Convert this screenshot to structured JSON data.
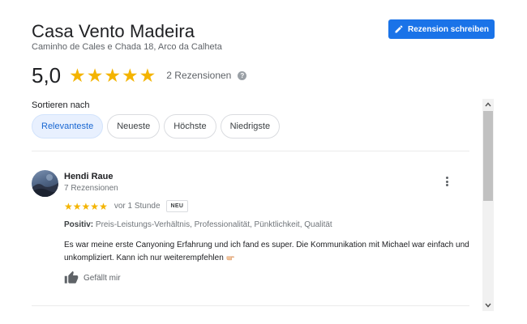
{
  "place": {
    "title": "Casa Vento Madeira",
    "address": "Caminho de Cales e Chada 18, Arco da Calheta"
  },
  "write_review": {
    "label": "Rezension schreiben",
    "icon": "pencil-icon"
  },
  "summary": {
    "rating": "5,0",
    "stars": 5,
    "review_count": "2 Rezensionen",
    "help_icon": "help-circle-icon"
  },
  "sort": {
    "label": "Sortieren nach",
    "options": [
      "Relevanteste",
      "Neueste",
      "Höchste",
      "Niedrigste"
    ],
    "selected": "Relevanteste"
  },
  "reviews": [
    {
      "name": "Hendi Raue",
      "reviewer_reviews": "7 Rezensionen",
      "stars": 5,
      "time": "vor 1 Stunde",
      "badge": "NEU",
      "positive_label": "Positiv:",
      "positive_items": "Preis-Leistungs-Verhältnis, Professionalität, Pünktlichkeit, Qualität",
      "text": "Es war meine erste Canyoning Erfahrung und ich fand es super. Die Kommunikation mit Michael war einfach und unkompliziert. Kann ich nur weiterempfehlen",
      "like_label": "Gefällt mir"
    }
  ],
  "colors": {
    "accent": "#1a73e8",
    "star": "#f4b400",
    "chip_active_bg": "#e8f0fe"
  }
}
